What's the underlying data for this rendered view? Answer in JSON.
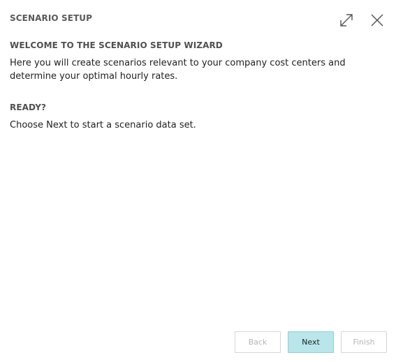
{
  "dialog": {
    "title": "SCENARIO SETUP",
    "icons": {
      "expand": "expand-icon",
      "close": "close-icon"
    }
  },
  "welcome": {
    "heading": "WELCOME TO THE SCENARIO SETUP WIZARD",
    "text": "Here you will create scenarios relevant to your company cost centers and determine your optimal hourly rates."
  },
  "ready": {
    "heading": "READY?",
    "text": "Choose Next to start a scenario data set."
  },
  "footer": {
    "back_label": "Back",
    "next_label": "Next",
    "finish_label": "Finish"
  },
  "colors": {
    "primary_button_bg": "#b8e6eb",
    "primary_button_border": "#8ccfd6",
    "disabled_text": "#b5b5b5"
  }
}
